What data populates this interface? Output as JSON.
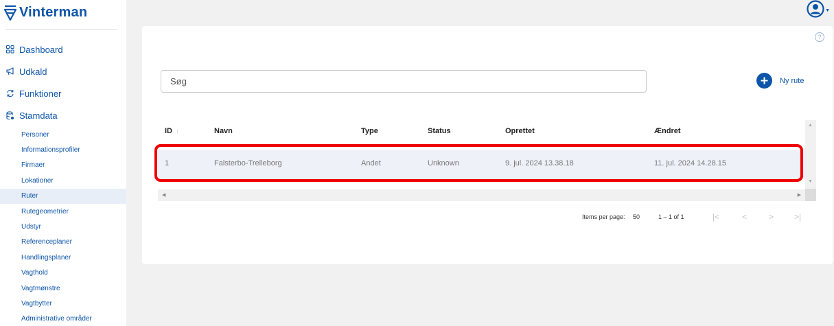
{
  "app": {
    "name": "Vinterman",
    "brand_color": "#0d55a8"
  },
  "sidebar": {
    "items": [
      {
        "label": "Dashboard",
        "icon": "dashboard-icon"
      },
      {
        "label": "Udkald",
        "icon": "megaphone-icon"
      },
      {
        "label": "Funktioner",
        "icon": "sync-icon"
      },
      {
        "label": "Stamdata",
        "icon": "database-icon"
      }
    ],
    "stamdata_sub": [
      "Personer",
      "Informationsprofiler",
      "Firmaer",
      "Lokationer",
      "Ruter",
      "Rutegeometrier",
      "Udstyr",
      "Referenceplaner",
      "Handlingsplaner",
      "Vagthold",
      "Vagtmønstre",
      "Vagtbytter",
      "Administrative områder"
    ],
    "active_sub": "Ruter"
  },
  "header": {
    "user_icon": "account-circle-icon"
  },
  "main": {
    "help_icon": "?",
    "search": {
      "placeholder": "Søg",
      "value": ""
    },
    "new_button_label": "Ny rute",
    "table": {
      "columns": {
        "id": "ID",
        "navn": "Navn",
        "type": "Type",
        "status": "Status",
        "oprettet": "Oprettet",
        "aendret": "Ændret"
      },
      "row": {
        "id": "1",
        "navn": "Falsterbo-Trelleborg",
        "type": "Andet",
        "status": "Unknown",
        "oprettet": "9. jul. 2024 13.38.18",
        "aendret": "11. jul. 2024 14.28.15"
      },
      "highlight_color": "#ee0000"
    },
    "paginator": {
      "items_per_page_label": "Items per page:",
      "page_size": "50",
      "range": "1 – 1 of 1"
    }
  }
}
